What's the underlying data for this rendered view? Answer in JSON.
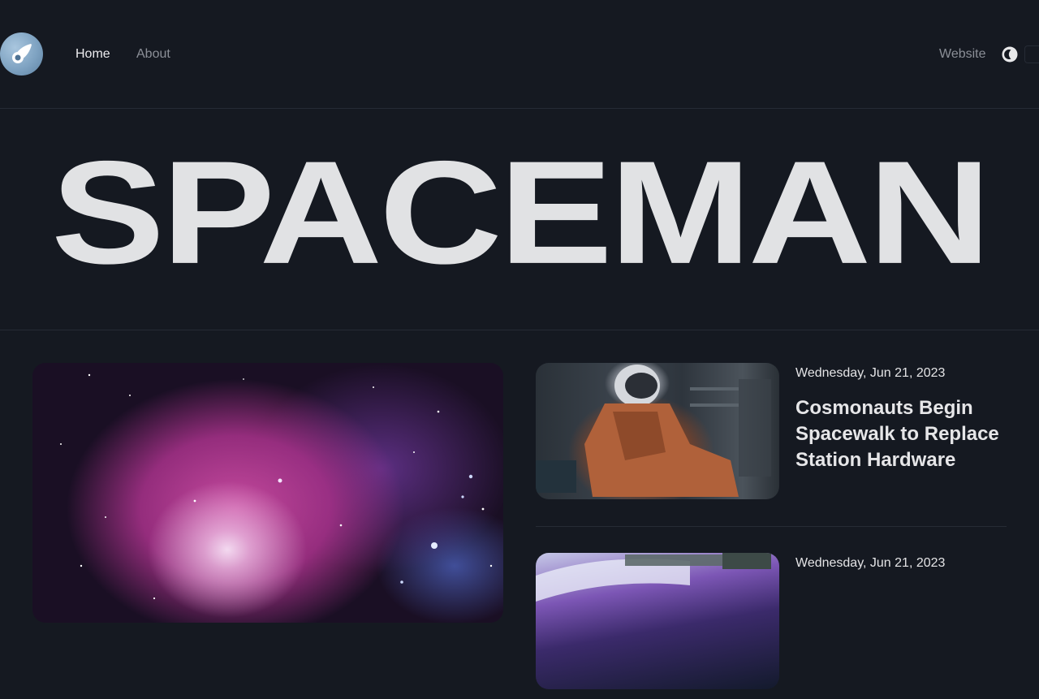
{
  "header": {
    "nav": {
      "home": "Home",
      "about": "About",
      "website": "Website"
    },
    "icons": {
      "logo": "comet-logo-icon",
      "theme_toggle": "moon-icon"
    }
  },
  "hero": {
    "title": "SPACEMAN"
  },
  "posts": [
    {
      "date": "Wednesday, Jun 21, 2023",
      "title": "Cosmonauts Begin Spacewalk to Replace Station Hardware"
    },
    {
      "date": "Wednesday, Jun 21, 2023",
      "title": ""
    }
  ],
  "colors": {
    "background": "#151921",
    "text": "#e4e4e6",
    "muted": "#8b8f97",
    "divider": "#262b35"
  }
}
